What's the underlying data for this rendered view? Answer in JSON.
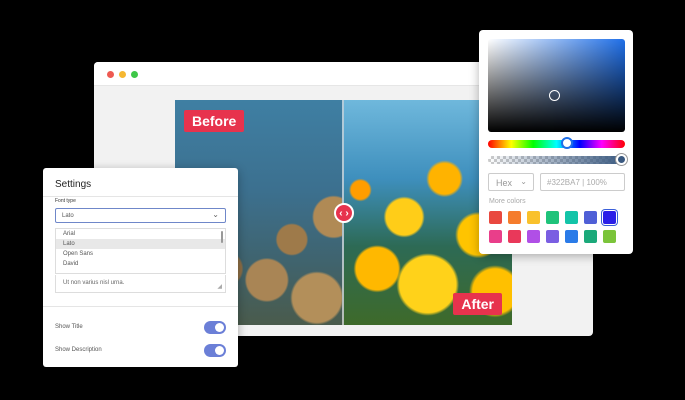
{
  "compare": {
    "before_label": "Before",
    "after_label": "After",
    "handle_glyph": "‹ ›"
  },
  "settings": {
    "title": "Settings",
    "font_type_label": "Font type",
    "font_selected": "Lato",
    "font_options": [
      "Arial",
      "Lato",
      "Open Sans",
      "David"
    ],
    "description_value": "Ut non varius nisl urna.",
    "toggles": [
      {
        "label": "Show Title",
        "on": true
      },
      {
        "label": "Show Description",
        "on": true
      }
    ]
  },
  "picker": {
    "mode": "Hex",
    "value": "#322BA7 | 100%",
    "more_colors_label": "More colors",
    "swatches_row1": [
      "#e9483f",
      "#f57c2c",
      "#f9c12c",
      "#1fc37a",
      "#13c4a8",
      "#4f5fd6",
      "#2b1fe8"
    ],
    "swatches_row2": [
      "#e93e8a",
      "#e9385a",
      "#b04fe6",
      "#7a5ee2",
      "#2a7be8",
      "#1ba97a",
      "#7bc43a"
    ]
  },
  "icons": {
    "chevron": "chevron-down-icon",
    "handle": "arrows-horizontal-icon"
  }
}
